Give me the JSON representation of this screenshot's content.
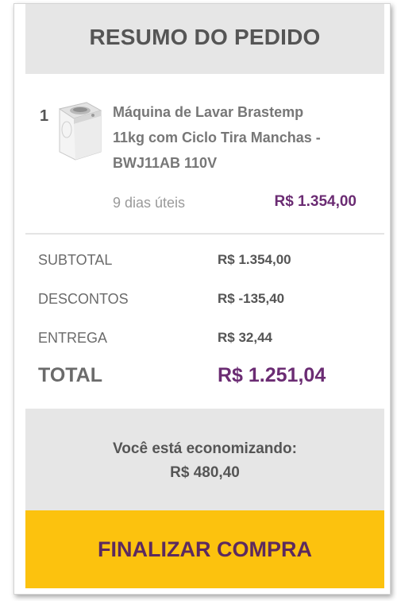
{
  "header": {
    "title": "RESUMO DO PEDIDO"
  },
  "item": {
    "quantity": "1",
    "name_lines": [
      "Máquina de Lavar Brastemp",
      "11kg com Ciclo Tira Manchas -",
      "BWJ11AB 110V"
    ],
    "delivery_time": "9 dias úteis",
    "price": "R$ 1.354,00"
  },
  "summary": {
    "subtotal": {
      "label": "SUBTOTAL",
      "value": "R$ 1.354,00"
    },
    "discount": {
      "label": "DESCONTOS",
      "value": "R$ -135,40"
    },
    "delivery": {
      "label": "ENTREGA",
      "value": "R$ 32,44"
    },
    "total": {
      "label": "TOTAL",
      "value": "R$ 1.251,04"
    }
  },
  "savings": {
    "label": "Você está economizando:",
    "amount": "R$ 480,40"
  },
  "checkout": {
    "button_label": "FINALIZAR COMPRA"
  },
  "colors": {
    "accent": "#6b2c73",
    "cta_background": "#fcc20e",
    "panel_gray": "#e6e6e6"
  },
  "icons": {
    "product_image": "washing-machine-icon"
  }
}
